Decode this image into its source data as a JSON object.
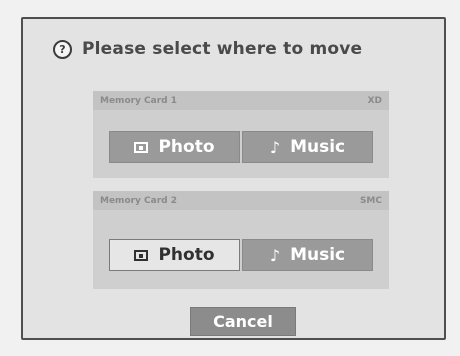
{
  "dialog": {
    "title": "Please select where to move",
    "help_icon_glyph": "?",
    "sections": [
      {
        "label": "Memory Card 1",
        "type": "XD",
        "photo_label": "Photo",
        "music_label": "Music",
        "music_icon_glyph": "♪",
        "selected": "none"
      },
      {
        "label": "Memory Card 2",
        "type": "SMC",
        "photo_label": "Photo",
        "music_label": "Music",
        "music_icon_glyph": "♪",
        "selected": "photo"
      }
    ],
    "cancel_label": "Cancel"
  },
  "colors": {
    "dialog_bg": "#e3e3e3",
    "button_dark": "#9a9a9a",
    "button_highlight": "#e6e6e6"
  },
  "icons": {
    "help": "help-icon",
    "photo": "photo-icon",
    "music": "music-note-icon"
  }
}
